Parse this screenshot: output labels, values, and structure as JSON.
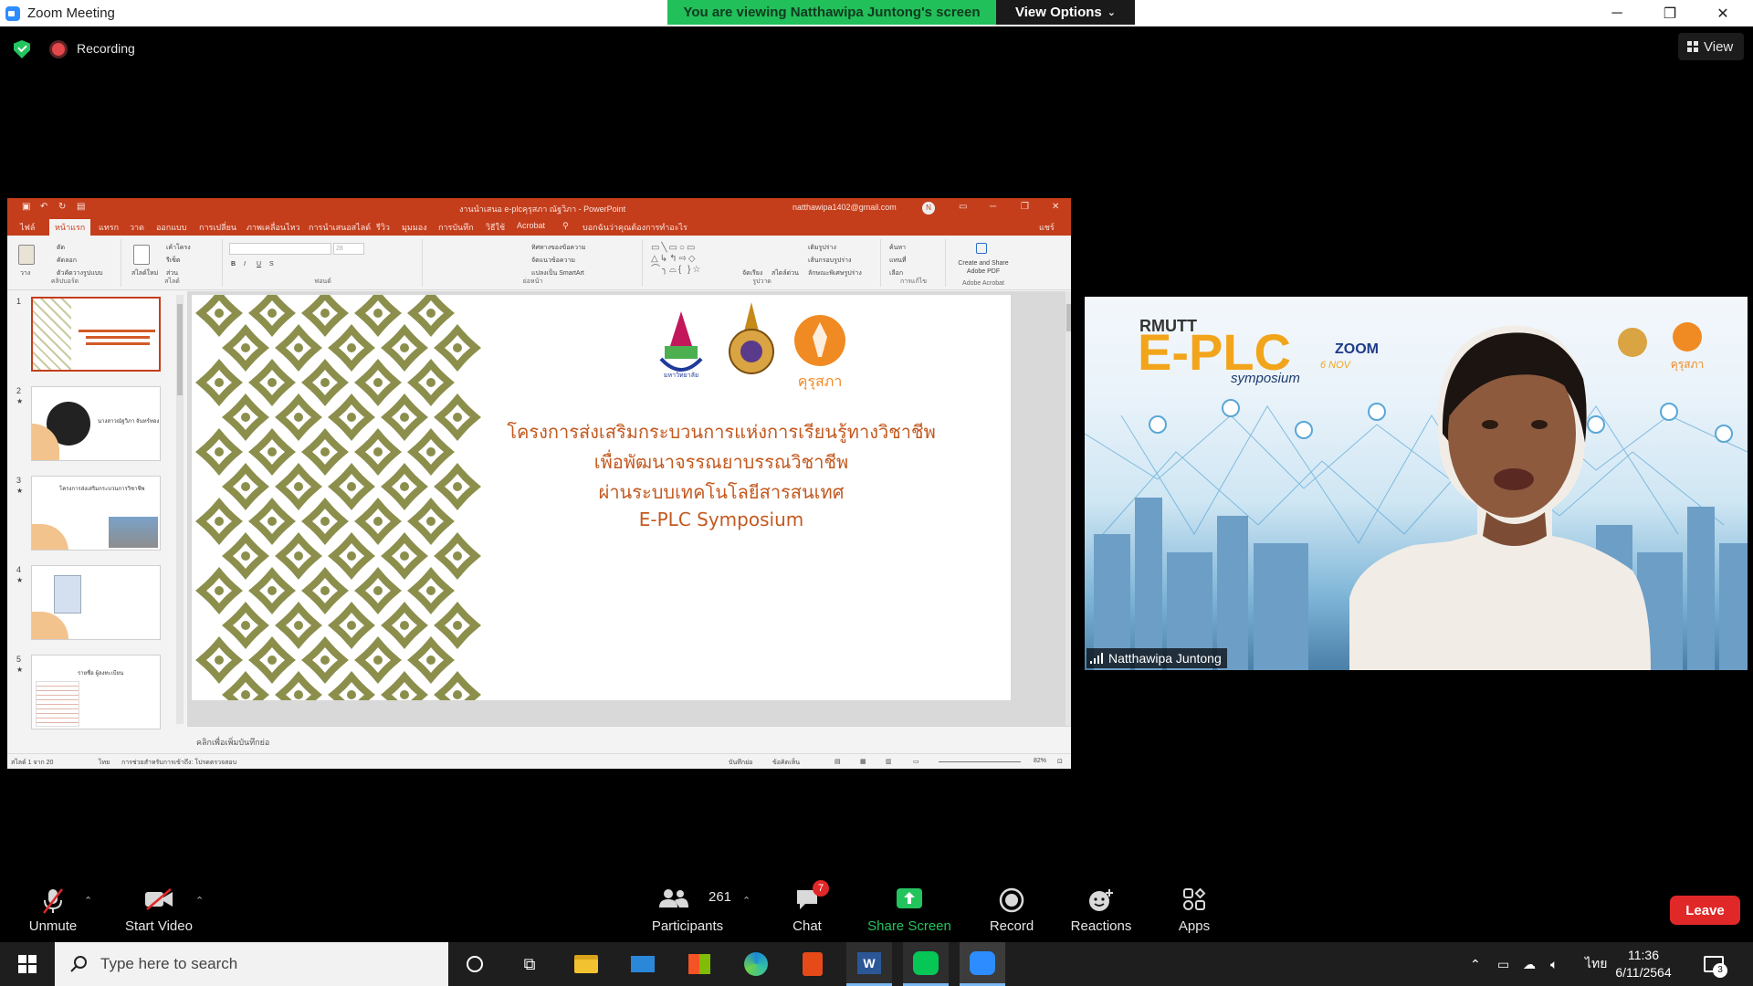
{
  "window": {
    "title": "Zoom Meeting",
    "banner": "You are viewing Natthawipa Juntong's screen",
    "view_options": "View Options",
    "minimize": "─",
    "restore": "❐",
    "close": "✕"
  },
  "meeting_bar": {
    "recording_label": "Recording",
    "view_label": "View",
    "colors": {
      "shield": "#23c45e",
      "recording": "#e4484a"
    }
  },
  "powerpoint": {
    "title": "งานนำเสนอ e-plcคุรุสภา ณัฐวิภา - PowerPoint",
    "account": "natthawipa1402@gmail.com",
    "avatar_initial": "N",
    "tabs": [
      "ไฟล์",
      "หน้าแรก",
      "แทรก",
      "วาด",
      "ออกแบบ",
      "การเปลี่ยน",
      "ภาพเคลื่อนไหว",
      "การนำเสนอสไลด์",
      "รีวิว",
      "มุมมอง",
      "การบันทึก",
      "วิธีใช้",
      "Acrobat",
      "บอกฉันว่าคุณต้องการทำอะไร"
    ],
    "share": "แชร์",
    "ribbon": {
      "clipboard": {
        "paste": "วาง",
        "cut": "ตัด",
        "copy": "คัดลอก",
        "format_painter": "ตัวคัดวางรูปแบบ",
        "group": "คลิปบอร์ด"
      },
      "slides": {
        "new_slide": "สไลด์ใหม่",
        "layout": "เค้าโครง",
        "reset": "รีเซ็ต",
        "section": "ส่วน",
        "group": "สไลด์"
      },
      "font": {
        "size": "28",
        "bold": "B",
        "italic": "I",
        "underline": "U",
        "strike": "S",
        "group": "ฟอนต์"
      },
      "paragraph": {
        "text_direction": "ทิศทางของข้อความ",
        "align_text": "จัดแนวข้อความ",
        "smartart": "แปลงเป็น SmartArt",
        "group": "ย่อหน้า"
      },
      "drawing": {
        "arrange": "จัดเรียง",
        "quick_styles": "สไตล์ด่วน",
        "fill": "เติมรูปร่าง",
        "outline": "เส้นกรอบรูปร่าง",
        "effects": "ลักษณะพิเศษรูปร่าง",
        "group": "รูปวาด"
      },
      "editing": {
        "find": "ค้นหา",
        "replace": "แทนที่",
        "select": "เลือก",
        "group": "การแก้ไข"
      },
      "acrobat": {
        "label": "Create and Share Adobe PDF",
        "group": "Adobe Acrobat"
      }
    },
    "slide_numbers": [
      "1",
      "2",
      "3",
      "4",
      "5"
    ],
    "thumb2_name": "นางสาวณัฐวิภา จันทร์ทอง",
    "thumb3_title": "โครงการส่งเสริมกระบวนการวิชาชีพ",
    "thumb5_title": "รายชื่อ ผู้ลงทะเบียน",
    "slide": {
      "logo_text": "คุรุสภา",
      "logo1_text": "มหาวิทยาลัย",
      "line1": "โครงการส่งเสริมกระบวนการแห่งการเรียนรู้ทางวิชาชีพ",
      "line2": "เพื่อพัฒนาจรรณยาบรรณวิชาชีพ",
      "line3": "ผ่านระบบเทคโนโลยีสารสนเทศ",
      "line4": "E-PLC Symposium"
    },
    "notes_placeholder": "คลิกเพื่อเพิ่มบันทึกย่อ",
    "status": {
      "slide_count": "สไลด์ 1 จาก 20",
      "language": "ไทย",
      "accessibility": "การช่วยสำหรับการเข้าถึง: โปรดตรวจสอบ",
      "notes": "บันทึกย่อ",
      "comments": "ข้อคิดเห็น",
      "zoom": "82%"
    }
  },
  "video": {
    "participant_name": "Natthawipa Juntong",
    "bg_brand": "RMUTT",
    "bg_title": "E-PLC",
    "bg_subtitle": "symposium",
    "bg_zoom": "ZOOM",
    "bg_date": "6 NOV",
    "bg_logo_text": "คุรุสภา"
  },
  "toolbar": {
    "unmute": "Unmute",
    "start_video": "Start Video",
    "participants": "Participants",
    "participant_count": "261",
    "chat": "Chat",
    "chat_badge": "7",
    "share_screen": "Share Screen",
    "record": "Record",
    "reactions": "Reactions",
    "apps": "Apps",
    "leave": "Leave",
    "colors": {
      "share": "#23c45e",
      "leave": "#e02828",
      "badge": "#e02828"
    }
  },
  "taskbar": {
    "search_placeholder": "Type here to search",
    "language": "ไทย",
    "time": "11:36",
    "date": "6/11/2564",
    "notification_count": "3",
    "apps": [
      "cortana-icon",
      "task-view-icon",
      "file-explorer-icon",
      "mail-icon",
      "store-icon",
      "edge-icon",
      "office-icon",
      "word-icon",
      "line-icon",
      "zoom-icon"
    ]
  }
}
